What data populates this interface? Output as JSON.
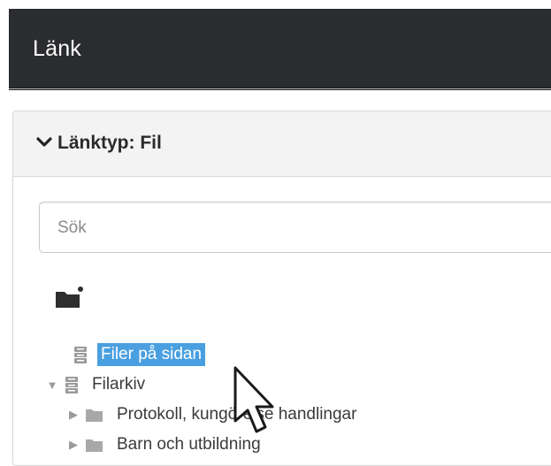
{
  "window": {
    "title": "Länk"
  },
  "panel": {
    "heading": "Länktyp: Fil"
  },
  "search": {
    "placeholder": "Sök"
  },
  "tree": {
    "nodes": [
      {
        "label": "Filer på sidan",
        "selected": true,
        "icon": "server-icon"
      },
      {
        "label": "Filarkiv",
        "expanded": true,
        "icon": "server-icon"
      },
      {
        "label": "Protokoll, kungörelse handlingar",
        "icon": "folder-icon"
      },
      {
        "label": "Barn och utbildning",
        "icon": "folder-icon"
      }
    ]
  },
  "colors": {
    "titlebar": "#2a2c2f",
    "selection": "#4a9fe0",
    "panel_heading": "#f3f3f3"
  }
}
